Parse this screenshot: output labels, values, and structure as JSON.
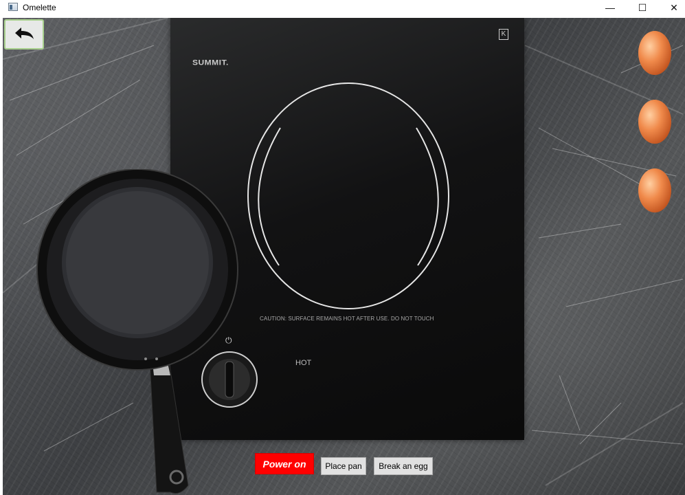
{
  "window": {
    "title": "Omelette",
    "controls": {
      "minimize": "—",
      "maximize": "☐",
      "close": "✕"
    }
  },
  "scene": {
    "back_icon": "back-arrow-icon",
    "cooktop": {
      "brand": "SUMMIT.",
      "corner_mark": "K",
      "caution_text": "CAUTION: SURFACE REMAINS HOT AFTER USE. DO NOT TOUCH",
      "hot_label": "HOT",
      "power_symbol": "⏻"
    },
    "eggs": [
      "egg-1",
      "egg-2",
      "egg-3"
    ]
  },
  "controls": {
    "power_label": "Power on",
    "place_pan_label": "Place pan",
    "break_egg_label": "Break an egg"
  },
  "colors": {
    "power_button": "#ff0000",
    "egg": "#f08a4b",
    "back_button_border": "#a8d08d"
  }
}
